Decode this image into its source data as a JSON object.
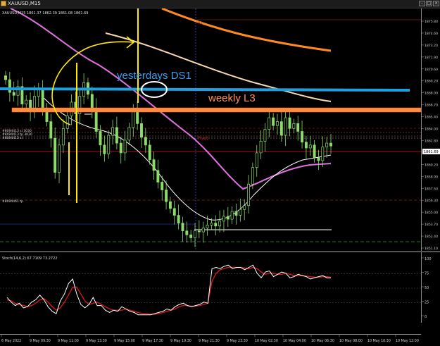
{
  "window": {
    "title": "XAUUSD,M15",
    "buttons": [
      "-",
      "□",
      "x"
    ]
  },
  "infobar": {
    "symbol": "XAUUSD,M15",
    "ohlc": "1861.37 1862.39 1861.08 1861.69"
  },
  "annotations": {
    "yesterday": "yesterdays DS1",
    "weekly": "weekly L3",
    "r1_tag": "R1",
    "pivot_tag": "Pivot"
  },
  "order_labels": {
    "l1": "#8094413 sl 3030",
    "l2": "#8094413 tp 3030",
    "l3": "#8094413 sl",
    "l4": "#8094461 tp"
  },
  "price_axis": {
    "labels": [
      "1875.80",
      "1874.60",
      "1873.20",
      "1871.90",
      "1870.60",
      "1869.20",
      "1868.00",
      "1866.70",
      "1865.40",
      "1864.00",
      "1862.80",
      "1861.69",
      "1860.20",
      "1858.90",
      "1857.50",
      "1856.30",
      "1855.00",
      "1853.70",
      "1852.40",
      "1851.10"
    ],
    "current": "1861.69"
  },
  "osc_info": "Stoch(14,6,2) 67.7109 73.2722",
  "osc_axis": {
    "labels": [
      "100",
      "75",
      "50",
      "25",
      "0"
    ]
  },
  "time_axis": {
    "labels": [
      "6 May 2022",
      "9 May 09:30",
      "9 May 11:00",
      "9 May 13:30",
      "9 May 15:00",
      "9 May 17:30",
      "9 May 19:30",
      "9 May 21:30",
      "9 May 23:30",
      "10 May 02:30",
      "10 May 04:00",
      "10 May 06:30",
      "10 May 08:00",
      "10 May 10:30",
      "10 May 12:00"
    ]
  },
  "colors": {
    "background": "#000000",
    "bull_candle": "#8ddc6a",
    "bear_candle": "#8ddc6a",
    "white_ma": "#ffffff",
    "magenta_ma": "#e070e0",
    "orange_ma": "#ff8a20",
    "cream_ma": "#f5d7b0",
    "blue_level": "#1ea0e0",
    "orange_level": "#ff8c40",
    "yellow_drawing": "#ffea00",
    "stoch_main": "#ffffff",
    "stoch_signal": "#d01818"
  },
  "chart_data": {
    "type": "line",
    "symbol": "XAUUSD",
    "timeframe": "M15",
    "ylim": [
      1851.1,
      1875.8
    ],
    "closes": [
      1868.5,
      1867.2,
      1866.9,
      1867.8,
      1866.0,
      1866.4,
      1865.2,
      1866.8,
      1867.5,
      1865.6,
      1864.2,
      1862.5,
      1859.0,
      1861.8,
      1863.5,
      1864.8,
      1866.2,
      1865.0,
      1866.8,
      1868.2,
      1867.0,
      1865.5,
      1863.2,
      1861.8,
      1860.9,
      1862.8,
      1863.6,
      1862.0,
      1861.0,
      1862.3,
      1863.6,
      1865.2,
      1864.0,
      1862.6,
      1861.8,
      1860.3,
      1859.2,
      1858.0,
      1857.2,
      1856.0,
      1855.3,
      1854.6,
      1853.8,
      1853.0,
      1852.6,
      1852.3,
      1853.0,
      1852.9,
      1853.3,
      1853.6,
      1853.8,
      1853.5,
      1854.0,
      1854.5,
      1854.2,
      1855.0,
      1854.6,
      1855.2,
      1855.6,
      1857.8,
      1859.5,
      1861.0,
      1862.2,
      1863.4,
      1864.6,
      1863.8,
      1864.2,
      1862.8,
      1864.6,
      1863.5,
      1864.0,
      1863.2,
      1862.1,
      1861.5,
      1861.8,
      1860.5,
      1860.2,
      1861.6,
      1862.0,
      1861.7
    ],
    "stoch_main": [
      34,
      26,
      20,
      24,
      16,
      18,
      26,
      30,
      38,
      30,
      18,
      10,
      6,
      28,
      40,
      58,
      66,
      40,
      22,
      16,
      22,
      34,
      20,
      20,
      12,
      8,
      12,
      10,
      18,
      14,
      10,
      8,
      4,
      4,
      4,
      4,
      6,
      8,
      10,
      14,
      12,
      18,
      22,
      24,
      20,
      18,
      20,
      22,
      26,
      24,
      84,
      86,
      84,
      88,
      90,
      84,
      86,
      86,
      82,
      86,
      90,
      76,
      68,
      78,
      80,
      70,
      74,
      78,
      76,
      68,
      70,
      74,
      72,
      70,
      66,
      68,
      70,
      72,
      68,
      68
    ],
    "stoch_signal": [
      30,
      28,
      24,
      22,
      20,
      18,
      20,
      24,
      30,
      32,
      26,
      18,
      12,
      16,
      26,
      38,
      52,
      52,
      40,
      28,
      22,
      24,
      26,
      22,
      18,
      14,
      12,
      12,
      12,
      14,
      12,
      10,
      8,
      6,
      6,
      5,
      5,
      6,
      8,
      10,
      12,
      14,
      18,
      20,
      20,
      19,
      19,
      20,
      22,
      24,
      62,
      76,
      82,
      84,
      86,
      86,
      86,
      86,
      85,
      84,
      86,
      84,
      78,
      74,
      76,
      76,
      74,
      74,
      76,
      74,
      72,
      72,
      72,
      71,
      70,
      69,
      69,
      70,
      70,
      69
    ],
    "stoch_levels": [
      0,
      25,
      50,
      75,
      100
    ],
    "horizontal_levels": [
      {
        "label": "yesterdays DS1",
        "price": 1868.0
      },
      {
        "label": "weekly L3",
        "price": 1866.7
      },
      {
        "label": "",
        "price": 1864.0
      },
      {
        "label": "",
        "price": 1861.7
      },
      {
        "label": "",
        "price": 1858.9
      },
      {
        "label": "",
        "price": 1853.7
      },
      {
        "label": "",
        "price": 1852.4
      }
    ]
  }
}
